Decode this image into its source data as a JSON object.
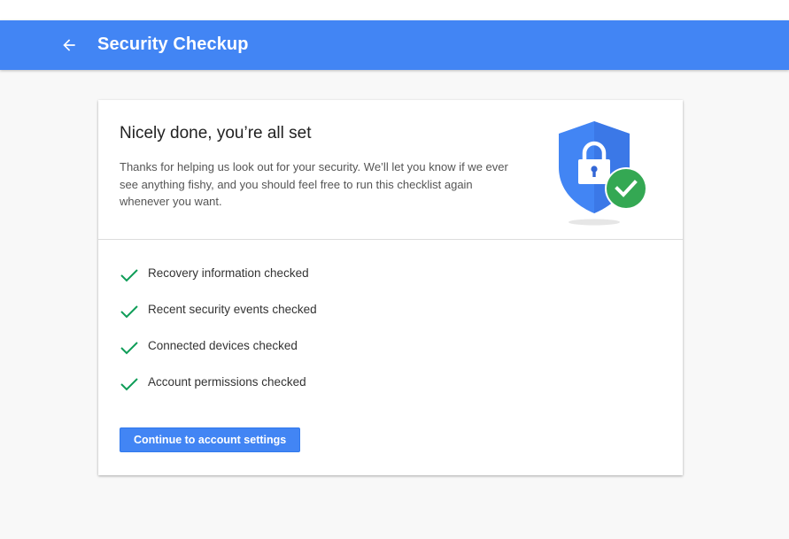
{
  "header": {
    "title": "Security Checkup",
    "back_icon": "arrow-back-icon"
  },
  "card": {
    "headline": "Nicely done, you’re all set",
    "description": "Thanks for helping us look out for your security. We’ll let you know if we ever see anything fishy, and you should feel free to run this checklist again whenever you want.",
    "illustration_icon": "shield-lock-check-icon",
    "checklist": [
      {
        "label": "Recovery information checked",
        "icon": "checkmark-icon"
      },
      {
        "label": "Recent security events checked",
        "icon": "checkmark-icon"
      },
      {
        "label": "Connected devices checked",
        "icon": "checkmark-icon"
      },
      {
        "label": "Account permissions checked",
        "icon": "checkmark-icon"
      }
    ],
    "continue_label": "Continue to account settings"
  },
  "colors": {
    "app_bar": "#4285f4",
    "shield": "#4285f4",
    "check_badge": "#34a853",
    "checkmark": "#0f9d58",
    "background": "#f8f8f8"
  }
}
